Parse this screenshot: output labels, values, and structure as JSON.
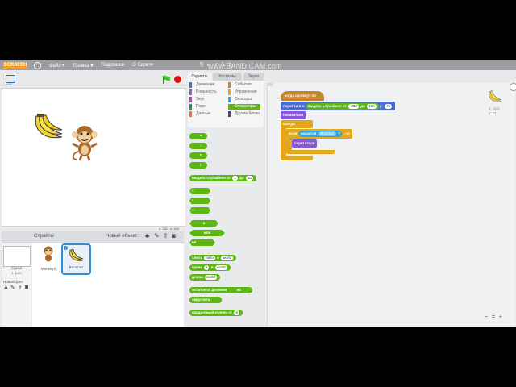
{
  "recording": {
    "watermark": "www.BANDICAM.com"
  },
  "menu": {
    "file": "Файл ▾",
    "edit": "Правка ▾",
    "hints": "Подсказки",
    "about": "О Скретч",
    "logo": "SCRATCH"
  },
  "stage": {
    "version": "v461",
    "coords_x": "x: 181",
    "coords_y": "y: 180"
  },
  "sprites": {
    "header": "Спрайты",
    "new_object": "Новый объект:",
    "stage_label": "Сцена",
    "stage_backdrops": "1 фон",
    "new_backdrop": "Новый фон:",
    "items": [
      {
        "label": "Monkey2",
        "selected": false
      },
      {
        "label": "Bananas",
        "selected": true
      }
    ]
  },
  "tabs": [
    "Скрипты",
    "Костюмы",
    "Звуки"
  ],
  "categories": {
    "left": [
      "Движение",
      "Внешность",
      "Звук",
      "Перо",
      "Данные"
    ],
    "right": [
      "События",
      "Управление",
      "Сенсоры",
      "Операторы",
      "Другие блоки"
    ],
    "selected": "Операторы"
  },
  "palette_blocks": {
    "random": [
      "выдать случайное от",
      "1",
      "до",
      "10"
    ],
    "and": "и",
    "or": "или",
    "not": "не",
    "join": [
      "слить",
      "hello",
      "и",
      "world"
    ],
    "letter": [
      "буква",
      "1",
      "в",
      "world"
    ],
    "length": [
      "длина",
      "world"
    ],
    "mod": [
      "остаток от деления",
      "на"
    ],
    "round": "округлить",
    "sqrt": [
      "квадратный корень",
      "от",
      "9"
    ]
  },
  "script": {
    "hat": "когда щелкнут по",
    "goto": [
      "перейти в х:",
      "выдать случайное от",
      "-232",
      "до",
      "190",
      "y:",
      "71"
    ],
    "show": "показаться",
    "forever": "всегда",
    "if": [
      "если",
      "касается",
      "Monkey2",
      "?",
      ", то"
    ],
    "hide": "спрятаться"
  },
  "sprite_info": {
    "x": "x: -121",
    "y": "y: 71"
  },
  "zoom": [
    "−",
    "=",
    "+"
  ],
  "colors": {
    "looks": "#8a55d7",
    "control": "#e1a91a",
    "motion": "#4a6cd4",
    "operators": "#5cb712",
    "events": "#c88330"
  }
}
